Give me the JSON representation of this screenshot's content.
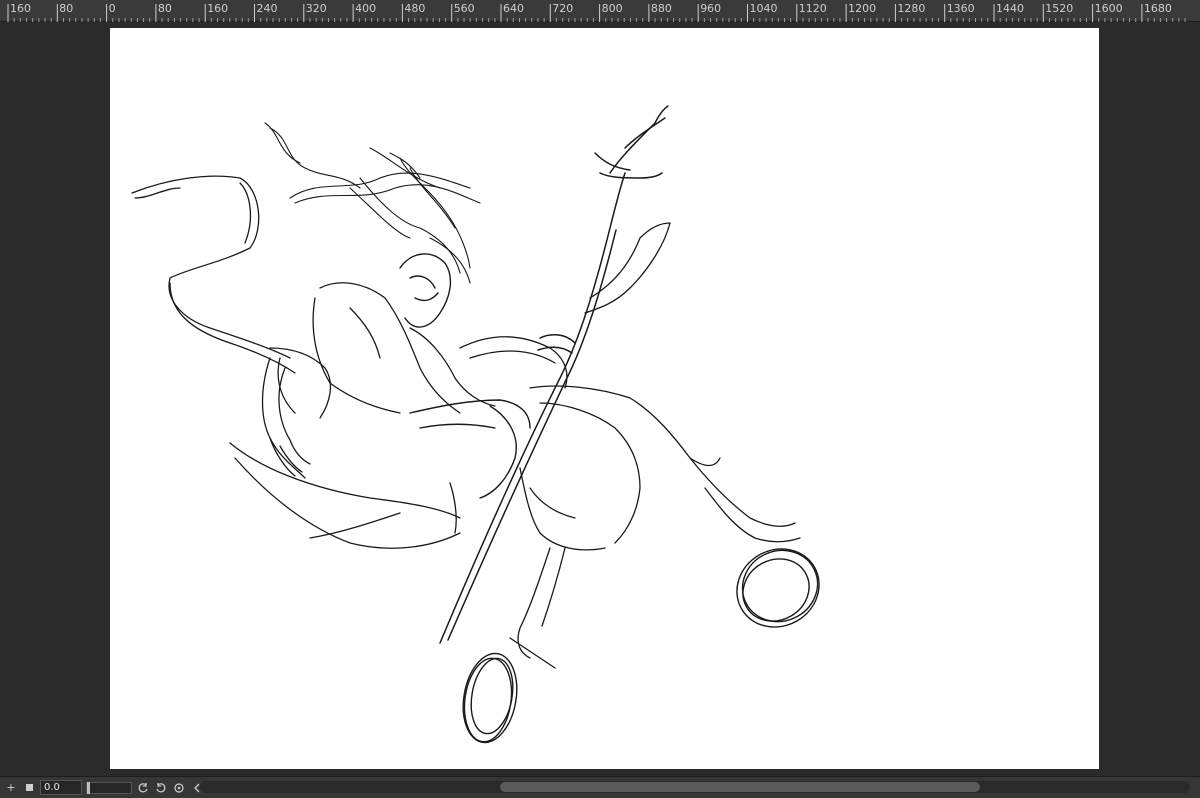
{
  "ruler": {
    "labels": [
      "160",
      "80",
      "0",
      "80",
      "160",
      "240",
      "320",
      "400",
      "480",
      "560",
      "640",
      "720",
      "800",
      "880",
      "960",
      "1040",
      "1120",
      "1200",
      "1280",
      "1360",
      "1440",
      "1520",
      "1600",
      "1680"
    ]
  },
  "statusbar": {
    "zoom_value": "0.0",
    "add_icon": "plus-icon",
    "stop_icon": "square-icon",
    "rotate_ccw_icon": "rotate-left-icon",
    "rotate_cw_icon": "rotate-right-icon",
    "reset_icon": "reset-rotation-icon",
    "collapse_icon": "chevron-left-icon"
  },
  "colors": {
    "workspace": "#2b2b2b",
    "canvas": "#ffffff",
    "ink": "#1a1a1a"
  }
}
